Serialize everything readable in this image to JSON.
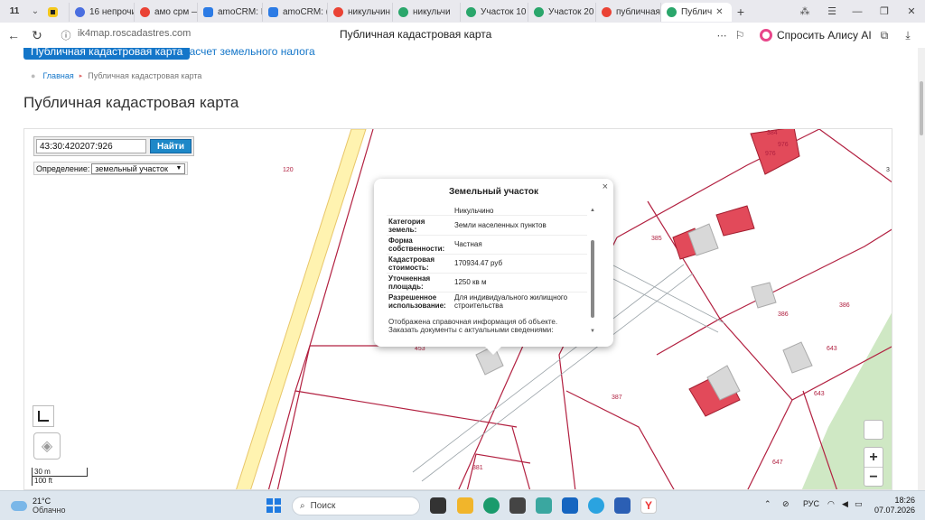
{
  "browser": {
    "tab_count": "11",
    "tabs": [
      {
        "label": "",
        "color": "#f4c81d"
      },
      {
        "label": "16 непрочи",
        "color": "#4a6ee0"
      },
      {
        "label": "амо срм —",
        "color": "#ea4335"
      },
      {
        "label": "amoCRM: I",
        "color": "#2c7be5"
      },
      {
        "label": "amoCRM: (",
        "color": "#2c7be5"
      },
      {
        "label": "никульчин",
        "color": "#ea4335"
      },
      {
        "label": "никульчи",
        "color": "#2aa66b"
      },
      {
        "label": "Участок 10",
        "color": "#2aa66b"
      },
      {
        "label": "Участок 20",
        "color": "#2aa66b"
      },
      {
        "label": "публичная",
        "color": "#ea4335"
      },
      {
        "label": "Публич",
        "color": "#2aa66b",
        "active": true
      }
    ],
    "url": "ik4map.roscadastres.com",
    "page_title": "Публичная кадастровая карта",
    "alice_label": "Спросить Алису AI"
  },
  "site": {
    "top_button": "Публичная кадастровая карта",
    "top_link": "Расчет земельного налога",
    "breadcrumb_home": "Главная",
    "breadcrumb_current": "Публичная кадастровая карта",
    "heading": "Публичная кадастровая карта"
  },
  "map": {
    "search_value": "43:30:420207:926",
    "search_button": "Найти",
    "definition_label": "Определение:",
    "definition_value": "земельный участок",
    "scale_metric": "30 m",
    "scale_imperial": "100 ft",
    "zoom_in": "+",
    "zoom_out": "−",
    "plot_labels": [
      "120",
      "384",
      "976",
      "976",
      "3",
      "385",
      "386",
      "386",
      "453",
      "387",
      "643",
      "643",
      "647",
      "381",
      "926"
    ]
  },
  "popup": {
    "title": "Земельный участок",
    "close": "×",
    "top_value": "Никульчино",
    "rows": [
      {
        "key": "Категория земель:",
        "value": "Земли населенных пунктов"
      },
      {
        "key": "Форма собственности:",
        "value": "Частная"
      },
      {
        "key": "Кадастровая стоимость:",
        "value": "170934.47 руб"
      },
      {
        "key": "Уточненная площадь:",
        "value": "1250 кв м"
      },
      {
        "key": "Разрешенное использование:",
        "value": "Для индивидуального жилищного строительства"
      }
    ],
    "footer": "Отображена справочная информация об объекте. Заказать документы с актуальными сведениями:"
  },
  "taskbar": {
    "temperature": "21°C",
    "condition": "Облачно",
    "search_placeholder": "Поиск",
    "language": "РУС",
    "time": "18:26",
    "date": "07.07.2026"
  }
}
